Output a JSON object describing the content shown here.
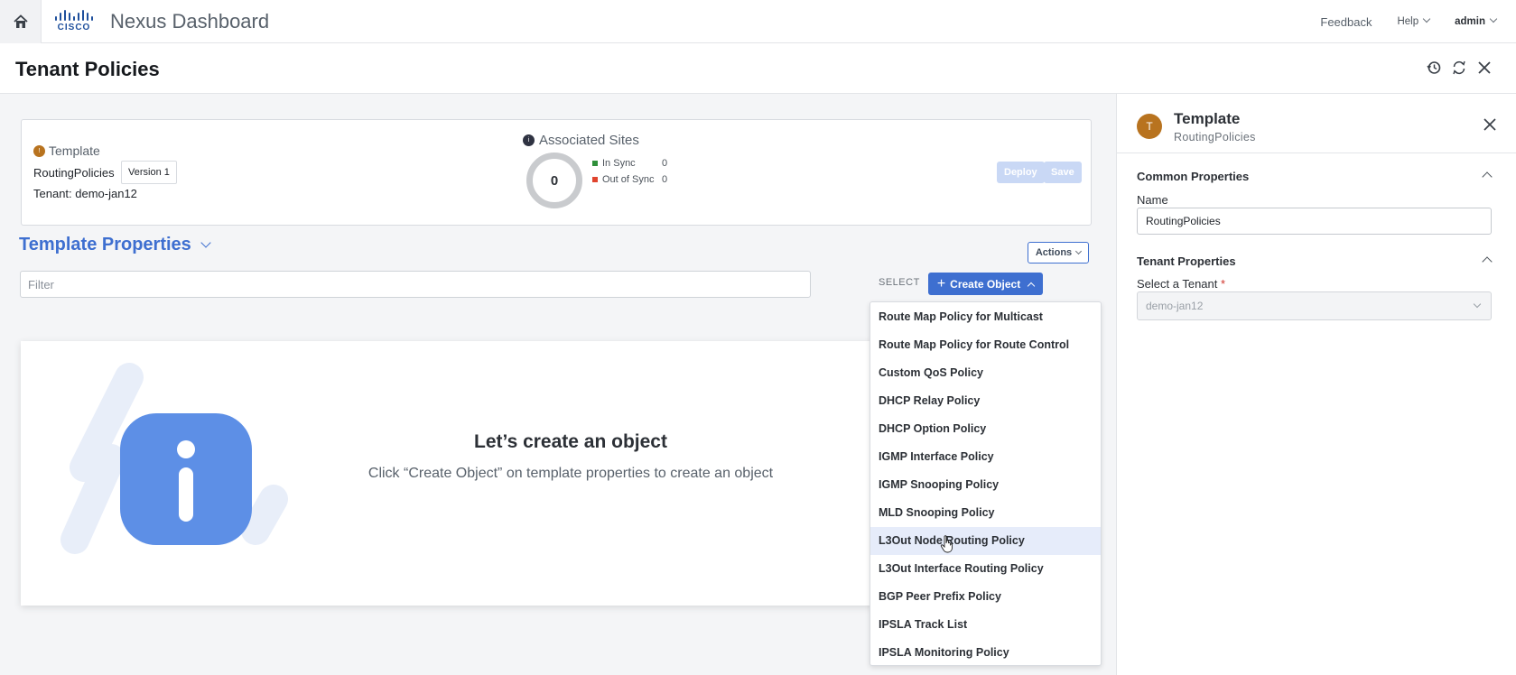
{
  "topbar": {
    "brand": "CISCO",
    "app_title": "Nexus Dashboard",
    "feedback": "Feedback",
    "help": "Help",
    "user": "admin"
  },
  "page": {
    "title": "Tenant Policies"
  },
  "summary": {
    "template_label": "Template",
    "template_name": "RoutingPolicies",
    "version": "Version 1",
    "tenant": "Tenant: demo-jan12",
    "associated_sites_label": "Associated Sites",
    "sites_total": "0",
    "in_sync_label": "In Sync",
    "in_sync_count": "0",
    "out_of_sync_label": "Out of Sync",
    "out_of_sync_count": "0",
    "deploy_label": "Deploy",
    "save_label": "Save",
    "colors": {
      "in_sync": "#2f8f3a",
      "out_of_sync": "#e0442e"
    }
  },
  "template_properties": {
    "title": "Template Properties",
    "actions_label": "Actions",
    "filter_placeholder": "Filter",
    "select_label": "SELECT",
    "create_object_label": "Create Object"
  },
  "empty_state": {
    "title": "Let’s create an object",
    "subtitle": "Click “Create Object” on template properties to create an object"
  },
  "create_menu": {
    "items": [
      "Route Map Policy for Multicast",
      "Route Map Policy for Route Control",
      "Custom QoS Policy",
      "DHCP Relay Policy",
      "DHCP Option Policy",
      "IGMP Interface Policy",
      "IGMP Snooping Policy",
      "MLD Snooping Policy",
      "L3Out Node Routing Policy",
      "L3Out Interface Routing Policy",
      "BGP Peer Prefix Policy",
      "IPSLA Track List",
      "IPSLA Monitoring Policy"
    ],
    "highlighted_index": 8
  },
  "side_panel": {
    "avatar_letter": "T",
    "title": "Template",
    "subtitle": "RoutingPolicies",
    "common_properties": "Common Properties",
    "name_label": "Name",
    "name_value": "RoutingPolicies",
    "tenant_properties": "Tenant Properties",
    "tenant_label": "Select a Tenant",
    "tenant_required_mark": "*",
    "tenant_value": "demo-jan12"
  },
  "accent_color": "#3e6fd0"
}
